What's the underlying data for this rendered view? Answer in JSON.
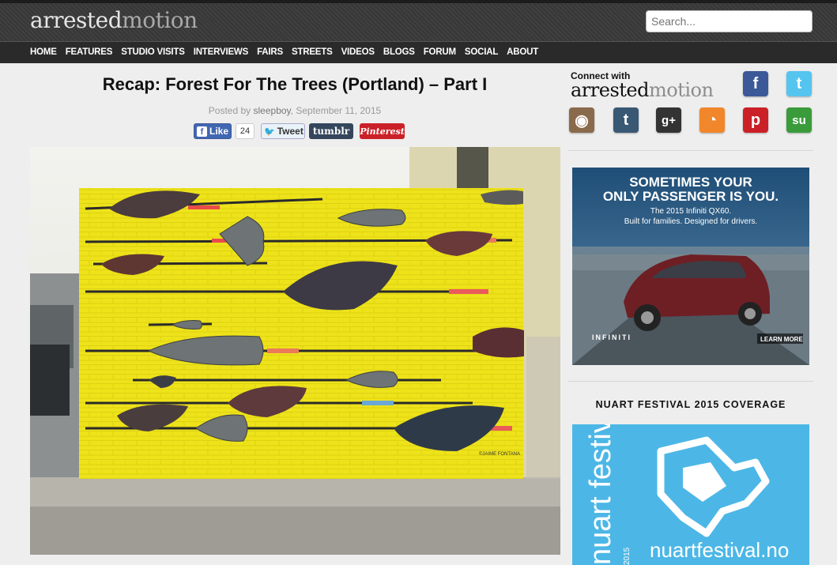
{
  "site": {
    "logo_part1": "arrested",
    "logo_part2": "motion",
    "search_placeholder": "Search..."
  },
  "nav": [
    "HOME",
    "FEATURES",
    "STUDIO VISITS",
    "INTERVIEWS",
    "FAIRS",
    "STREETS",
    "VIDEOS",
    "BLOGS",
    "FORUM",
    "SOCIAL",
    "ABOUT"
  ],
  "article": {
    "title": "Recap: Forest For The Trees (Portland) – Part I",
    "posted_by": "Posted by",
    "author": "sleepboy",
    "date": ", September 11, 2015",
    "share": {
      "like_label": "Like",
      "like_count": "24",
      "tweet_label": "Tweet",
      "tumblr_label": "tumblr",
      "pinterest_label": "Pinterest"
    },
    "mural_signature": "©JAIME FONTANA"
  },
  "sidebar": {
    "connect_small": "Connect with",
    "connect_logo1": "arrested",
    "connect_logo2": "motion",
    "social_icons": [
      {
        "name": "facebook-icon",
        "glyph": "f",
        "color": "#3b5998"
      },
      {
        "name": "twitter-icon",
        "glyph": "t",
        "color": "#55c5ef"
      },
      {
        "name": "instagram-icon",
        "glyph": "◉",
        "color": "#8a6a4c"
      },
      {
        "name": "tumblr-icon",
        "glyph": "t",
        "color": "#395874"
      },
      {
        "name": "google-plus-icon",
        "glyph": "g+",
        "color": "#333333"
      },
      {
        "name": "rss-icon",
        "glyph": "◔",
        "color": "#f1862a"
      },
      {
        "name": "pinterest-icon",
        "glyph": "p",
        "color": "#cb2027"
      },
      {
        "name": "stumbleupon-icon",
        "glyph": "su",
        "color": "#3a9b3a"
      }
    ],
    "ad": {
      "headline1": "SOMETIMES YOUR",
      "headline2": "ONLY PASSENGER IS YOU.",
      "sub1": "The 2015 Infiniti QX60.",
      "sub2": "Built for families. Designed for drivers.",
      "brand": "INFINITI",
      "cta": "LEARN MORE"
    },
    "nuart": {
      "heading": "NUART FESTIVAL 2015 COVERAGE",
      "vertical_text": "nuart festival",
      "year": "2015",
      "url": "nuartfestival.no"
    }
  }
}
